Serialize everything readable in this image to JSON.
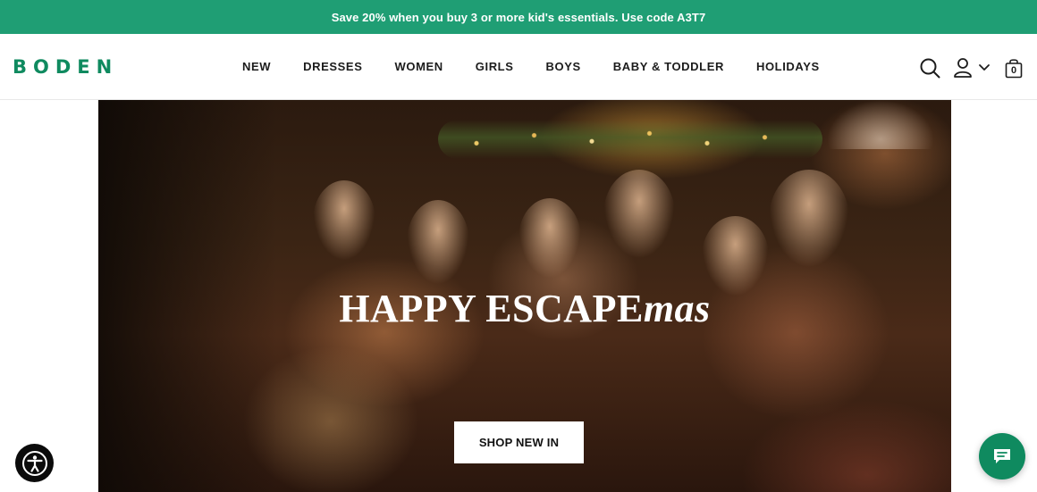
{
  "promo": {
    "text": "Save 20% when you buy 3 or more kid's essentials. Use code A3T7"
  },
  "header": {
    "logo": "BODEN",
    "nav": {
      "new": "NEW",
      "dresses": "DRESSES",
      "women": "WOMEN",
      "girls": "GIRLS",
      "boys": "BOYS",
      "baby": "BABY & TODDLER",
      "holidays": "HOLIDAYS"
    },
    "icons": {
      "search": "search-icon",
      "account": "user-icon",
      "chevron": "chevron-down-icon",
      "bag": "shopping-bag-icon"
    },
    "bag_count": "0"
  },
  "hero": {
    "title_main": "HAPPY ESCAPE",
    "title_italic": "mas",
    "cta": "SHOP NEW IN"
  },
  "floating": {
    "accessibility_icon": "accessibility-icon",
    "chat_icon": "chat-icon"
  },
  "colors": {
    "brand_green": "#0f8a5f",
    "promo_green": "#1f9e74",
    "text_dark": "#1c1c1c",
    "white": "#ffffff"
  }
}
